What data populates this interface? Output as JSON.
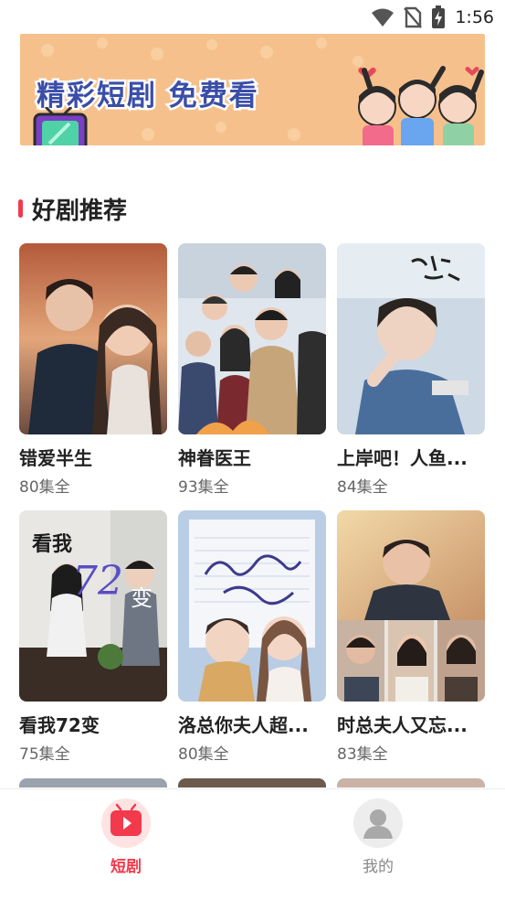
{
  "status_bar": {
    "time": "1:56",
    "icons": [
      "wifi-icon",
      "no-sim-icon",
      "battery-charging-icon"
    ]
  },
  "banner": {
    "text": "精彩短剧 免费看"
  },
  "section": {
    "title": "好剧推荐"
  },
  "dramas": [
    {
      "title": "错爱半生",
      "count": "80集全"
    },
    {
      "title": "神眷医王",
      "count": "93集全"
    },
    {
      "title": "上岸吧！人鱼...",
      "count": "84集全"
    },
    {
      "title": "看我72变",
      "count": "75集全"
    },
    {
      "title": "洛总你夫人超...",
      "count": "80集全"
    },
    {
      "title": "时总夫人又忘...",
      "count": "83集全"
    }
  ],
  "nav": {
    "items": [
      {
        "label": "短剧",
        "icon": "tv-play-icon",
        "active": true
      },
      {
        "label": "我的",
        "icon": "user-icon",
        "active": false
      }
    ]
  },
  "colors": {
    "accent": "#f23a4c",
    "banner_bg": "#f6c08c",
    "banner_text": "#3a4ea8"
  }
}
